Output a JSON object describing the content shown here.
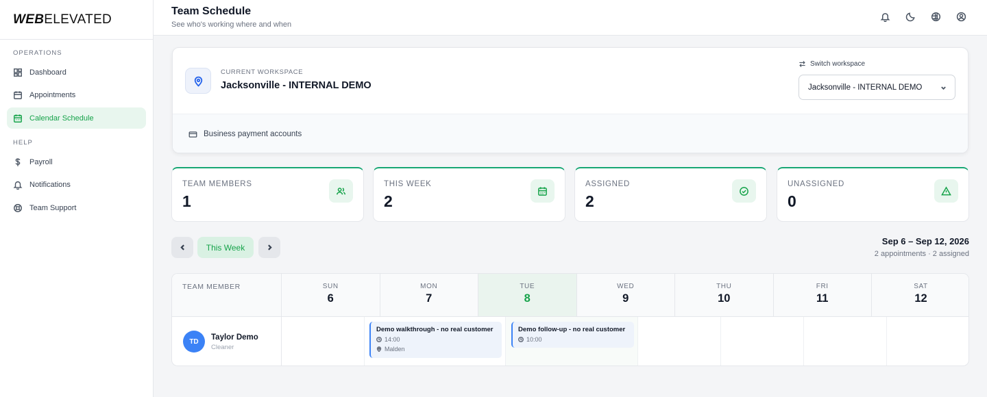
{
  "brand": {
    "logo_bold": "WEB",
    "logo_light": "ELEVATED"
  },
  "sidebar": {
    "sections": [
      {
        "heading": "OPERATIONS",
        "items": [
          {
            "label": "Dashboard",
            "icon": "dashboard-icon",
            "active": false
          },
          {
            "label": "Appointments",
            "icon": "calendar-icon",
            "active": false
          },
          {
            "label": "Calendar Schedule",
            "icon": "calendar-schedule-icon",
            "active": true
          }
        ]
      },
      {
        "heading": "HELP",
        "items": [
          {
            "label": "Payroll",
            "icon": "dollar-icon",
            "active": false
          },
          {
            "label": "Notifications",
            "icon": "bell-icon",
            "active": false
          },
          {
            "label": "Team Support",
            "icon": "lifebuoy-icon",
            "active": false
          }
        ]
      }
    ]
  },
  "header": {
    "title": "Team Schedule",
    "subtitle": "See who's working where and when",
    "icons": [
      "bell-icon",
      "moon-icon",
      "globe-icon",
      "user-circle-icon"
    ]
  },
  "workspace": {
    "label": "CURRENT WORKSPACE",
    "name": "Jacksonville - INTERNAL DEMO",
    "switch_label": "Switch workspace",
    "selected": "Jacksonville - INTERNAL DEMO",
    "payment_link": "Business payment accounts"
  },
  "stats": [
    {
      "label": "TEAM MEMBERS",
      "value": "1",
      "icon": "users-icon"
    },
    {
      "label": "THIS WEEK",
      "value": "2",
      "icon": "calendar-icon"
    },
    {
      "label": "ASSIGNED",
      "value": "2",
      "icon": "check-circle-icon"
    },
    {
      "label": "UNASSIGNED",
      "value": "0",
      "icon": "warning-icon"
    }
  ],
  "week_nav": {
    "this_week": "This Week",
    "range": "Sep 6 – Sep 12, 2026",
    "summary": "2 appointments · 2 assigned"
  },
  "calendar": {
    "member_header": "TEAM MEMBER",
    "days": [
      {
        "name": "SUN",
        "num": "6",
        "today": false
      },
      {
        "name": "MON",
        "num": "7",
        "today": false
      },
      {
        "name": "TUE",
        "num": "8",
        "today": true
      },
      {
        "name": "WED",
        "num": "9",
        "today": false
      },
      {
        "name": "THU",
        "num": "10",
        "today": false
      },
      {
        "name": "FRI",
        "num": "11",
        "today": false
      },
      {
        "name": "SAT",
        "num": "12",
        "today": false
      }
    ],
    "member": {
      "initials": "TD",
      "name": "Taylor Demo",
      "role": "Cleaner",
      "avatar_color": "#3b82f6"
    },
    "appointments": [
      {
        "title": "Demo walkthrough - no real customer",
        "time": "14:00",
        "location": "Malden"
      },
      {
        "title": "Demo follow-up - no real customer",
        "time": "10:00"
      }
    ]
  },
  "colors": {
    "accent": "#16a34a",
    "accent_bg": "#e8f6ee",
    "stat_border": "#17a673",
    "appt_border": "#3b82f6"
  }
}
